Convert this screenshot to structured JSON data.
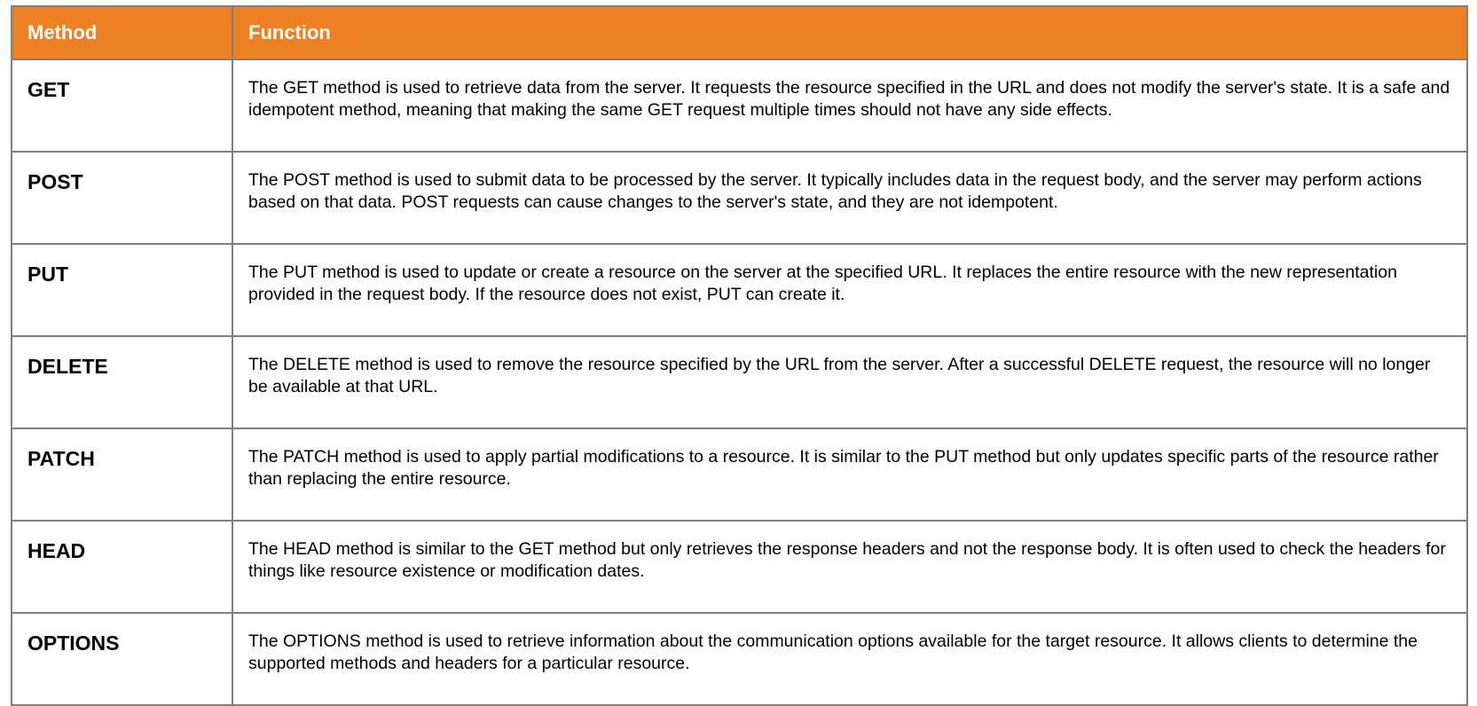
{
  "table": {
    "headers": {
      "method": "Method",
      "function": "Function"
    },
    "rows": [
      {
        "method": "GET",
        "function": "The GET method is used to retrieve data from the server. It requests the resource specified in the URL and does not modify the server's state. It is a safe and idempotent method, meaning that making the same GET request multiple times should not have any side effects."
      },
      {
        "method": "POST",
        "function": "The POST method is used to submit data to be processed by the server. It typically includes data in the request body, and the server may perform actions based on that data. POST requests can cause changes to the server's state, and they are not idempotent."
      },
      {
        "method": "PUT",
        "function": "The PUT method is used to update or create a resource on the server at the specified URL. It replaces the entire resource with the new representation provided in the request body. If the resource does not exist, PUT can create it."
      },
      {
        "method": "DELETE",
        "function": "The DELETE method is used to remove the resource specified by the URL from the server. After a successful DELETE request, the resource will no longer be available at that URL."
      },
      {
        "method": "PATCH",
        "function": "The PATCH method is used to apply partial modifications to a resource. It is similar to the PUT method but only updates specific parts of the resource rather than replacing the entire resource."
      },
      {
        "method": "HEAD",
        "function": "The HEAD method is similar to the GET method but only retrieves the response headers and not the response body. It is often used to check the headers for things like resource existence or modification dates."
      },
      {
        "method": "OPTIONS",
        "function": "The OPTIONS method is used to retrieve information about the communication options available for the target resource. It allows clients to determine the supported methods and headers for a particular resource."
      }
    ]
  },
  "colors": {
    "header_background": "#ee8123",
    "header_text": "#ffffff",
    "border": "#7f7f7f"
  }
}
